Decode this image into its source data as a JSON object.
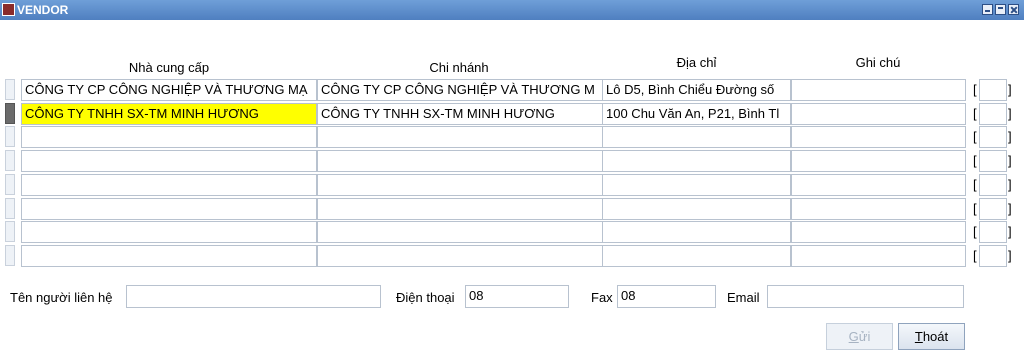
{
  "window": {
    "title": "VENDOR"
  },
  "columns": {
    "supplier": "Nhà cung cấp",
    "branch": "Chi nhánh",
    "address": "Địa chỉ",
    "note": "Ghi chú"
  },
  "rows": [
    {
      "supplier": "CÔNG TY CP CÔNG NGHIỆP VÀ THƯƠNG MẠ",
      "branch": "CÔNG TY CP CÔNG NGHIỆP VÀ THƯƠNG M",
      "address": "Lô D5, Bình Chiểu Đường số",
      "note": "",
      "selected": false
    },
    {
      "supplier": "CÔNG TY TNHH SX-TM MINH HƯƠNG",
      "branch": "CÔNG TY TNHH SX-TM MINH HƯƠNG",
      "address": "100 Chu Văn An, P21, Bình Tl",
      "note": "",
      "selected": true
    },
    {
      "supplier": "",
      "branch": "",
      "address": "",
      "note": "",
      "selected": false
    },
    {
      "supplier": "",
      "branch": "",
      "address": "",
      "note": "",
      "selected": false
    },
    {
      "supplier": "",
      "branch": "",
      "address": "",
      "note": "",
      "selected": false
    },
    {
      "supplier": "",
      "branch": "",
      "address": "",
      "note": "",
      "selected": false
    },
    {
      "supplier": "",
      "branch": "",
      "address": "",
      "note": "",
      "selected": false
    },
    {
      "supplier": "",
      "branch": "",
      "address": "",
      "note": "",
      "selected": false
    }
  ],
  "bracket_open": "[",
  "bracket_close": "]",
  "contact": {
    "contact_label": "Tên người liên hệ",
    "contact_value": "",
    "phone_label": "Điện thoại",
    "phone_value": "08",
    "fax_label": "Fax",
    "fax_value": "08",
    "email_label": "Email",
    "email_value": ""
  },
  "buttons": {
    "send_prefix": "",
    "send_mnemonic": "G",
    "send_rest": "ửi",
    "exit_prefix": "",
    "exit_mnemonic": "T",
    "exit_rest": "hoát"
  },
  "colors": {
    "highlight": "#ffff00",
    "titlebar": "#5a8ac8"
  }
}
